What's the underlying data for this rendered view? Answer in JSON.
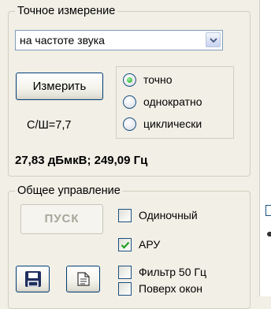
{
  "precise": {
    "legend": "Точное измерение",
    "mode_select": {
      "value": "на частоте звука"
    },
    "measure_button": "Измерить",
    "modes": [
      {
        "label": "точно",
        "checked": true
      },
      {
        "label": "однократно",
        "checked": false
      },
      {
        "label": "циклически",
        "checked": false
      }
    ],
    "snr": "С/Ш=7,7",
    "result": "27,83 дБмкВ; 249,09 Гц"
  },
  "general": {
    "legend": "Общее управление",
    "start_button": "ПУСК",
    "checkboxes": [
      {
        "label": "Одиночный",
        "checked": false
      },
      {
        "label": "АРУ",
        "checked": true
      },
      {
        "label": "Фильтр 50 Гц",
        "checked": false
      },
      {
        "label": "Поверх окон",
        "checked": false
      }
    ]
  },
  "colors": {
    "window_bg": "#f1efe6",
    "group_border": "#d0d0bf",
    "radio_dot": "#21a121",
    "check_mark": "#21a121",
    "disabled_text": "#a8a79b"
  },
  "icons": {
    "save": "floppy-disk-icon",
    "copy": "document-icon",
    "dropdown": "chevron-down-icon"
  }
}
